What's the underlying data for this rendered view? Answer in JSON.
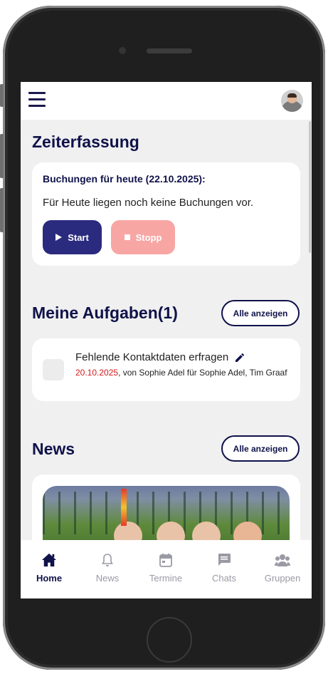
{
  "zeiterfassung": {
    "title": "Zeiterfassung",
    "card_title": "Buchungen für heute (22.10.2025):",
    "empty_text": "Für Heute liegen noch keine Buchungen vor.",
    "start_label": "Start",
    "stop_label": "Stopp"
  },
  "aufgaben": {
    "title": "Meine Aufgaben(1)",
    "show_all_label": "Alle anzeigen",
    "task": {
      "title": "Fehlende Kontaktdaten erfragen",
      "date": "20.10.2025",
      "meta": ", von Sophie Adel für Sophie Adel, Tim Graaf"
    }
  },
  "news": {
    "title": "News",
    "show_all_label": "Alle anzeigen"
  },
  "tabs": [
    {
      "label": "Home",
      "icon": "home-icon",
      "active": true
    },
    {
      "label": "News",
      "icon": "bell-icon",
      "active": false
    },
    {
      "label": "Termine",
      "icon": "calendar-icon",
      "active": false
    },
    {
      "label": "Chats",
      "icon": "chat-icon",
      "active": false
    },
    {
      "label": "Gruppen",
      "icon": "group-icon",
      "active": false
    }
  ],
  "colors": {
    "primary": "#10124a",
    "start_button": "#2a2b7e",
    "stop_button": "#f8a6a4",
    "date_red": "#d11a1a"
  }
}
